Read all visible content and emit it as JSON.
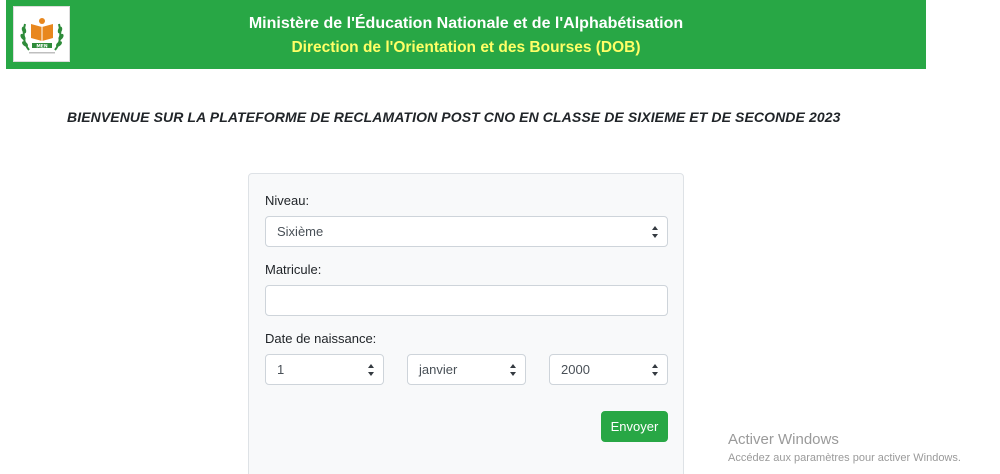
{
  "header": {
    "title": "Ministère de l'Éducation Nationale et de l'Alphabétisation",
    "subtitle": "Direction de l'Orientation et des Bourses (DOB)",
    "logo_text": "MEN"
  },
  "welcome": "BIENVENUE SUR LA PLATEFORME DE RECLAMATION POST CNO EN CLASSE DE SIXIEME ET DE SECONDE 2023",
  "form": {
    "niveau_label": "Niveau:",
    "niveau_value": "Sixième",
    "matricule_label": "Matricule:",
    "matricule_value": "",
    "dob_label": "Date de naissance:",
    "day_value": "1",
    "month_value": "janvier",
    "year_value": "2000",
    "submit_label": "Envoyer"
  },
  "watermark": {
    "title": "Activer Windows",
    "subtitle": "Accédez aux paramètres pour activer Windows."
  },
  "colors": {
    "header_bg": "#28a745",
    "subtitle": "#ffff66",
    "button": "#28a745"
  }
}
